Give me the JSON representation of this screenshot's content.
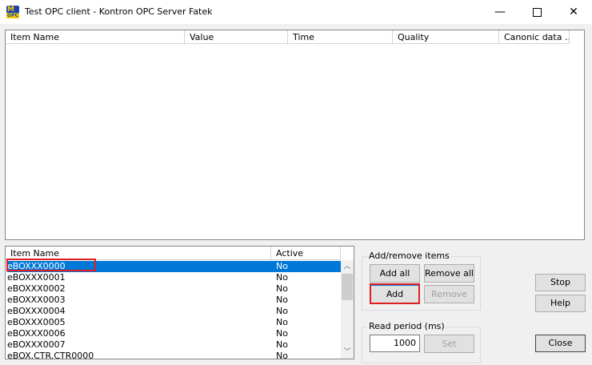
{
  "window": {
    "title": "Test OPC client - Kontron OPC Server Fatek",
    "minimize": "—",
    "close": "✕"
  },
  "top_list": {
    "columns": [
      "Item Name",
      "Value",
      "Time",
      "Quality",
      "Canonic data ..."
    ]
  },
  "bottom_list": {
    "columns": [
      "Item Name",
      "Active"
    ],
    "rows": [
      {
        "name": "eBOXXX0000",
        "active": "No"
      },
      {
        "name": "eBOXXX0001",
        "active": "No"
      },
      {
        "name": "eBOXXX0002",
        "active": "No"
      },
      {
        "name": "eBOXXX0003",
        "active": "No"
      },
      {
        "name": "eBOXXX0004",
        "active": "No"
      },
      {
        "name": "eBOXXX0005",
        "active": "No"
      },
      {
        "name": "eBOXXX0006",
        "active": "No"
      },
      {
        "name": "eBOXXX0007",
        "active": "No"
      },
      {
        "name": "eBOX.CTR.CTR0000",
        "active": "No"
      }
    ]
  },
  "add_remove": {
    "title": "Add/remove items",
    "add_all": "Add all",
    "remove_all": "Remove all",
    "add": "Add",
    "remove": "Remove"
  },
  "read_period": {
    "title": "Read period (ms)",
    "value": "1000",
    "set": "Set"
  },
  "side_buttons": {
    "stop": "Stop",
    "help": "Help",
    "close": "Close"
  },
  "colors": {
    "selection": "#0078d7",
    "highlight_box": "#e02020"
  }
}
